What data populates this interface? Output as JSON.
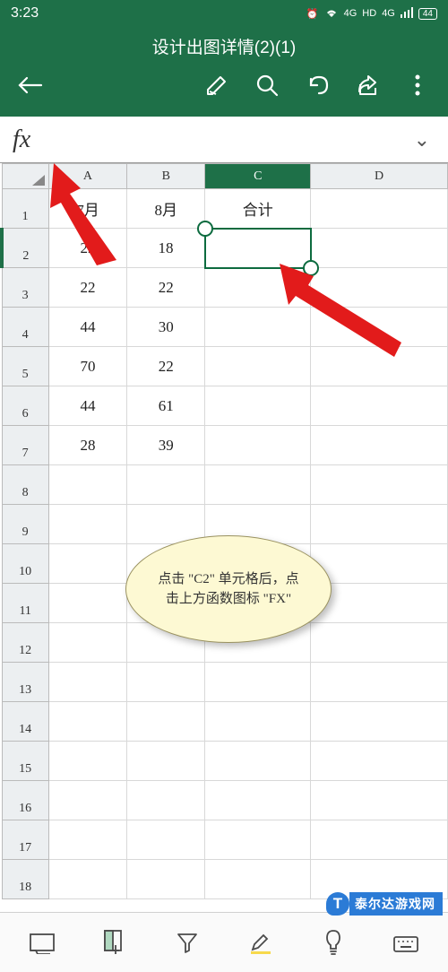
{
  "status": {
    "time": "3:23",
    "hd": "HD",
    "net": "4G",
    "battery": "44"
  },
  "header": {
    "title": "设计出图详情(2)(1)"
  },
  "formula_bar": {
    "fx": "fx"
  },
  "columns": [
    "A",
    "B",
    "C",
    "D"
  ],
  "rows": [
    "1",
    "2",
    "3",
    "4",
    "5",
    "6",
    "7",
    "8",
    "9",
    "10",
    "11",
    "12",
    "13",
    "14",
    "15",
    "16",
    "17",
    "18"
  ],
  "cells": {
    "A1": "7月",
    "B1": "8月",
    "C1": "合计",
    "A2": "22",
    "B2": "18",
    "A3": "22",
    "B3": "22",
    "A4": "44",
    "B4": "30",
    "A5": "70",
    "B5": "22",
    "A6": "44",
    "B6": "61",
    "A7": "28",
    "B7": "39"
  },
  "selected_cell": "C2",
  "callout": {
    "text": "点击 \"C2\" 单元格后，点击上方函数图标 \"FX\""
  },
  "watermark": {
    "badge": "T",
    "text": "泰尔达游戏网"
  }
}
